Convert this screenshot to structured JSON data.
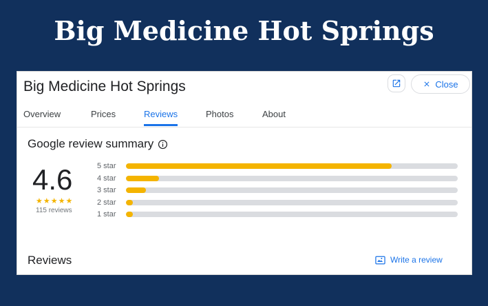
{
  "banner": {
    "title": "Big Medicine Hot Springs"
  },
  "panel": {
    "title": "Big Medicine Hot Springs",
    "close_label": "Close",
    "tabs": [
      {
        "label": "Overview",
        "active": false
      },
      {
        "label": "Prices",
        "active": false
      },
      {
        "label": "Reviews",
        "active": true
      },
      {
        "label": "Photos",
        "active": false
      },
      {
        "label": "About",
        "active": false
      }
    ],
    "summary": {
      "title": "Google review summary",
      "rating": "4.6",
      "review_count": "115 reviews",
      "stars_filled": 4.6,
      "breakdown": [
        {
          "label": "5 star",
          "fraction": 0.8
        },
        {
          "label": "4 star",
          "fraction": 0.1
        },
        {
          "label": "3 star",
          "fraction": 0.06
        },
        {
          "label": "2 star",
          "fraction": 0.02
        },
        {
          "label": "1 star",
          "fraction": 0.02
        }
      ]
    },
    "reviews": {
      "heading": "Reviews",
      "write_label": "Write a review"
    }
  },
  "colors": {
    "background": "#11305c",
    "accent": "#1a73e8",
    "star": "#f4b400",
    "bar_track": "#dadce0"
  },
  "icons": [
    "open-in-new-icon",
    "close-icon",
    "info-icon",
    "star-icon",
    "write-review-icon"
  ]
}
